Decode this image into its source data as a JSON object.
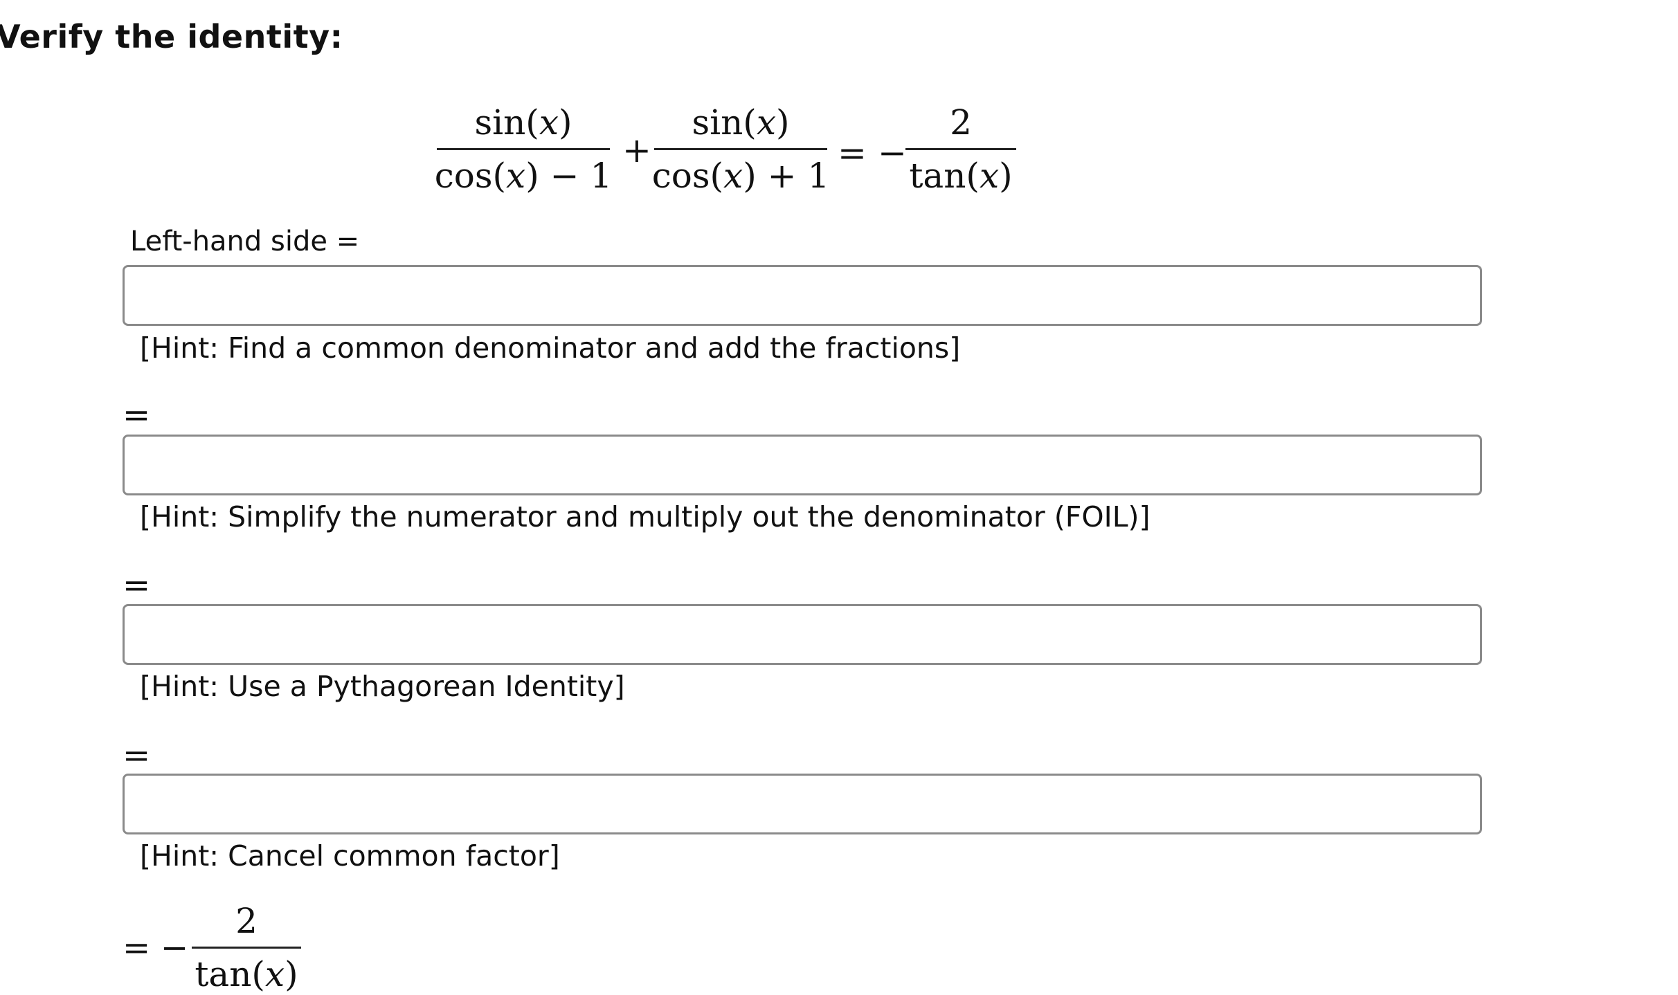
{
  "heading": "Verify the identity:",
  "identity": {
    "lhs_term1": {
      "num": [
        "sin(",
        "x",
        ")"
      ],
      "den": [
        "cos(",
        "x",
        ") − 1"
      ]
    },
    "plus": "+",
    "lhs_term2": {
      "num": [
        "sin(",
        "x",
        ")"
      ],
      "den": [
        "cos(",
        "x",
        ") + 1"
      ]
    },
    "equals": "=",
    "minus": "−",
    "rhs": {
      "num": "2",
      "den": [
        "tan(",
        "x",
        ")"
      ]
    }
  },
  "lhs_label": "Left-hand side =",
  "steps": [
    {
      "prefix": "",
      "value": "",
      "hint": "[Hint: Find a common denominator and add the fractions]"
    },
    {
      "prefix": "=",
      "value": "",
      "hint": "[Hint: Simplify the numerator and multiply out the denominator (FOIL)]"
    },
    {
      "prefix": "=",
      "value": "",
      "hint": "[Hint: Use a Pythagorean Identity]"
    },
    {
      "prefix": "=",
      "value": "",
      "hint": "[Hint: Cancel common factor]"
    }
  ],
  "final": {
    "equals": "=",
    "minus": "−",
    "num": "2",
    "den": [
      "tan(",
      "x",
      ")"
    ]
  }
}
